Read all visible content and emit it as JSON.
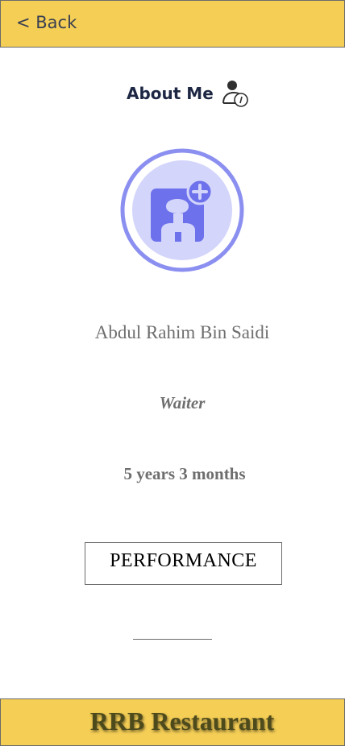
{
  "header": {
    "back_label": "< Back"
  },
  "about": {
    "title": "About Me"
  },
  "profile": {
    "name": "Abdul Rahim Bin Saidi",
    "role": "Waiter",
    "tenure": "5 years 3 months"
  },
  "actions": {
    "performance_label": "PERFORMANCE"
  },
  "footer": {
    "brand": "RRB Restaurant"
  },
  "colors": {
    "bar_yellow": "#f4ce55",
    "avatar_ring": "#8b8ff0",
    "avatar_fill": "#d3d5fb",
    "avatar_accent": "#6d71ec"
  }
}
